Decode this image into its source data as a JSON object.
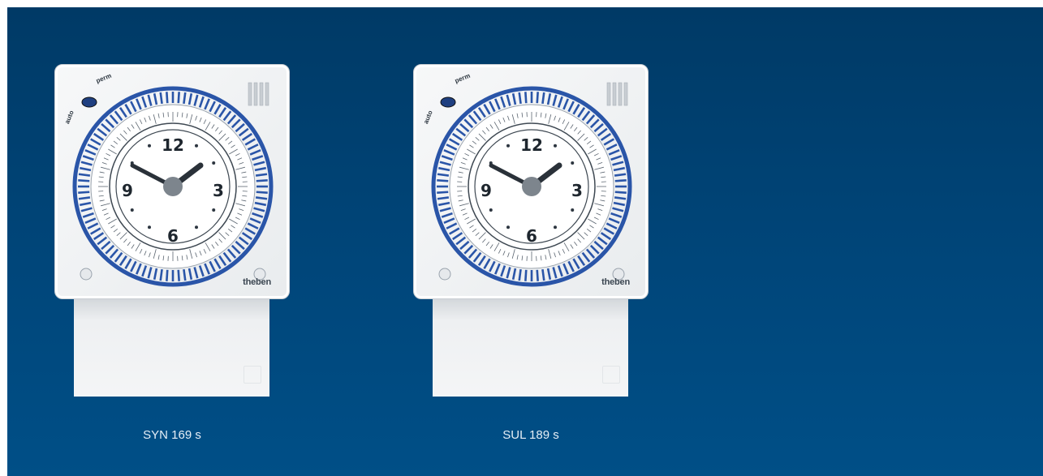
{
  "products": [
    {
      "name": "SYN 169 s",
      "brand": "theben",
      "mode_labels": [
        "perm",
        "auto"
      ],
      "dial_numbers": [
        "12",
        "3",
        "6",
        "9"
      ]
    },
    {
      "name": "SUL 189 s",
      "brand": "theben",
      "mode_labels": [
        "perm",
        "auto"
      ],
      "dial_numbers": [
        "12",
        "3",
        "6",
        "9"
      ]
    }
  ],
  "colors": {
    "background_top": "#003a66",
    "background_bottom": "#004f87",
    "segment_blue": "#2a55a8",
    "caption": "#e6eef6"
  }
}
